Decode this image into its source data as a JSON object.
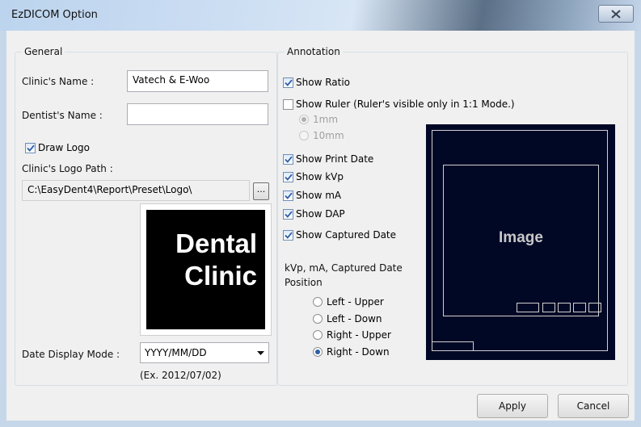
{
  "window": {
    "title": "EzDICOM Option"
  },
  "general": {
    "legend": "General",
    "clinic_name_label": "Clinic's Name :",
    "clinic_name_value": "Vatech & E-Woo",
    "dentist_name_label": "Dentist's Name :",
    "dentist_name_value": "",
    "draw_logo_label": "Draw Logo",
    "draw_logo_checked": true,
    "logo_path_label": "Clinic's Logo Path :",
    "logo_path_value": "C:\\EasyDent4\\Report\\Preset\\Logo\\",
    "browse_label": "...",
    "logo_line1": "Dental",
    "logo_line2": "Clinic",
    "date_mode_label": "Date Display Mode :",
    "date_mode_value": "YYYY/MM/DD",
    "date_mode_example": "(Ex. 2012/07/02)"
  },
  "annotation": {
    "legend": "Annotation",
    "show_ratio": {
      "label": "Show Ratio",
      "checked": true
    },
    "show_ruler": {
      "label": "Show Ruler (Ruler's visible only in 1:1 Mode.)",
      "checked": false
    },
    "ruler_options": [
      {
        "label": "1mm",
        "selected": true
      },
      {
        "label": "10mm",
        "selected": false
      }
    ],
    "show_print_date": {
      "label": "Show Print Date",
      "checked": true
    },
    "show_kvp": {
      "label": "Show kVp",
      "checked": true
    },
    "show_ma": {
      "label": "Show mA",
      "checked": true
    },
    "show_dap": {
      "label": "Show DAP",
      "checked": true
    },
    "show_captured_date": {
      "label": "Show Captured Date",
      "checked": true
    },
    "position_label_line1": "kVp, mA, Captured Date",
    "position_label_line2": "Position",
    "position_options": [
      {
        "label": "Left - Upper",
        "selected": false
      },
      {
        "label": "Left - Down",
        "selected": false
      },
      {
        "label": "Right - Upper",
        "selected": false
      },
      {
        "label": "Right - Down",
        "selected": true
      }
    ],
    "preview_text": "Image"
  },
  "buttons": {
    "apply": "Apply",
    "cancel": "Cancel"
  },
  "colors": {
    "preview_bg": "#000826",
    "check_accent": "#2c5fa8"
  }
}
